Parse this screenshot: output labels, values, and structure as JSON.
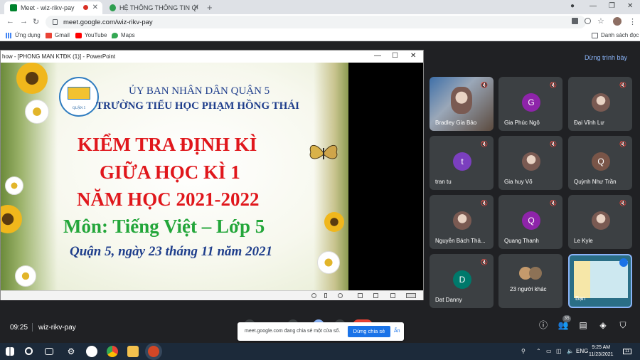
{
  "browser": {
    "tabs": [
      {
        "title": "Meet - wiz-rikv-pay"
      },
      {
        "title": "HỆ THỐNG THÔNG TIN QUẢN L..."
      }
    ],
    "url": "meet.google.com/wiz-rikv-pay",
    "bookmarks": [
      "Ứng dụng",
      "Gmail",
      "YouTube",
      "Maps"
    ],
    "reading_list": "Danh sách đọc"
  },
  "meet": {
    "stop_presenting": "Dừng trình bày",
    "time": "09:25",
    "meeting_code": "wiz-rikv-pay",
    "participant_count": "35",
    "participants": [
      {
        "name": "Bradley Gia Bảo",
        "type": "video"
      },
      {
        "name": "Gia Phúc Ngô",
        "initial": "G",
        "color": "#8e24aa"
      },
      {
        "name": "Đại Vĩnh Lư",
        "type": "photo"
      },
      {
        "name": "tran tu",
        "initial": "t",
        "color": "#7b3fbf"
      },
      {
        "name": "Gia huy Võ",
        "type": "photo"
      },
      {
        "name": "Quỳnh Như Trần",
        "initial": "Q",
        "color": "#795548"
      },
      {
        "name": "Nguyễn Bách Thả...",
        "type": "photo"
      },
      {
        "name": "Quang Thanh",
        "initial": "Q",
        "color": "#8e24aa"
      },
      {
        "name": "Le Kyle",
        "type": "photo"
      },
      {
        "name": "Dat Danny",
        "initial": "D",
        "color": "#00796b"
      },
      {
        "name": "23 người khác",
        "type": "others"
      },
      {
        "name": "Bạn",
        "type": "self"
      }
    ]
  },
  "powerpoint": {
    "title": "how - [PHONG MAN KTĐK  (1)] - PowerPoint",
    "slide": {
      "line1": "ỦY BAN NHÂN DÂN QUẬN 5",
      "line2": "TRƯỜNG TIỂU HỌC PHẠM HỒNG THÁI",
      "line3": "KIỂM TRA ĐỊNH KÌ",
      "line4": "GIỮA HỌC KÌ 1",
      "line5": "NĂM HỌC 2021-2022",
      "line6": "Môn: Tiếng Việt – Lớp 5",
      "line7": "Quận 5, ngày 23 tháng 11 năm 2021",
      "logo_text": "QUẬN 5"
    }
  },
  "share_notice": {
    "message": "meet.google.com đang chia sẻ một cửa sổ.",
    "stop_button": "Dừng chia sẻ",
    "hide_button": "Ẩn"
  },
  "taskbar": {
    "language": "ENG",
    "time": "9:25 AM",
    "date": "11/23/2021",
    "notifications": "11"
  }
}
